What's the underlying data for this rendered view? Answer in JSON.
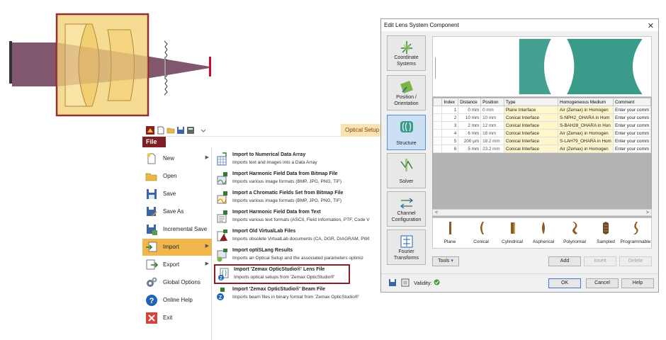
{
  "ribbon": {
    "context_tab": "Optical Setup",
    "file_tab": "File"
  },
  "file_menu": {
    "items": [
      {
        "label": "New",
        "icon": "new-document-icon",
        "has_arrow": true
      },
      {
        "label": "Open",
        "icon": "folder-open-icon",
        "has_arrow": false
      },
      {
        "label": "Save",
        "icon": "floppy-save-icon",
        "has_arrow": false
      },
      {
        "label": "Save As",
        "icon": "save-as-icon",
        "has_arrow": false
      },
      {
        "label": "Incremental Save",
        "icon": "incremental-save-icon",
        "has_arrow": false
      },
      {
        "label": "Import",
        "icon": "import-icon",
        "has_arrow": true,
        "active": true
      },
      {
        "label": "Export",
        "icon": "export-icon",
        "has_arrow": true
      },
      {
        "label": "Global Options",
        "icon": "gears-icon",
        "has_arrow": false
      },
      {
        "label": "Online Help",
        "icon": "help-icon",
        "has_arrow": false
      },
      {
        "label": "Exit",
        "icon": "exit-icon",
        "has_arrow": false
      }
    ]
  },
  "import_menu": {
    "items": [
      {
        "title": "Import to Numerical Data Array",
        "desc": "Imports text and images into a Data Array"
      },
      {
        "title": "Import Harmonic Field Data from Bitmap File",
        "desc": "Imports various image formats (BMP, JPG, PNG, TIF)"
      },
      {
        "title": "Import a Chromatic Fields Set from Bitmap File",
        "desc": "Imports various image formats (BMP, JPG, PNG, TIF)"
      },
      {
        "title": "Import Harmonic Field Data from Text",
        "desc": "Imports various text formats (ASCII, Field Information, PTF, Code V"
      },
      {
        "title": "Import Old VirtualLab Files",
        "desc": "Imports obsolete VirtualLab documents (CA, DGR, DIAGRAM, PWI"
      },
      {
        "title": "Import optiSLang Results",
        "desc": "Imports an Optical Setup and the associated parameters optimiz"
      },
      {
        "title": "Import 'Zemax OpticStudio®' Lens File",
        "desc": "Imports optical setups from 'Zemax OpticStudio®'",
        "highlighted": true
      },
      {
        "title": "Import 'Zemax OpticStudio®' Beam File",
        "desc": "Imports beam files in binary format from 'Zemax OpticStudio®'"
      }
    ]
  },
  "dialog": {
    "title": "Edit Lens System Component",
    "close_glyph": "✕",
    "side_buttons": [
      {
        "label": "Coordinate Systems",
        "icon": "coordinate-systems-icon"
      },
      {
        "label": "Position / Orientation",
        "icon": "position-orientation-icon"
      },
      {
        "label": "Structure",
        "icon": "structure-icon",
        "active": true
      },
      {
        "label": "Solver",
        "icon": "solver-icon"
      },
      {
        "label": "Channel Configuration",
        "icon": "channel-configuration-icon"
      },
      {
        "label": "Fourier Transforms",
        "icon": "fourier-transforms-icon"
      }
    ],
    "table": {
      "columns": [
        "Index",
        "Distance",
        "Position",
        "Type",
        "Homogeneous Medium",
        "Comment"
      ],
      "rows": [
        {
          "index": "1",
          "distance": "0 mm",
          "position": "0 mm",
          "type": "Plane Interface",
          "medium": "Air (Zemax) in Homogen",
          "comment": "Enter your comm"
        },
        {
          "index": "2",
          "distance": "10 mm",
          "position": "10 mm",
          "type": "Conical Interface",
          "medium": "S-NPH2_OHARA in Hom",
          "comment": "Enter your comm"
        },
        {
          "index": "3",
          "distance": "2 mm",
          "position": "12 mm",
          "type": "Conical Interface",
          "medium": "S-BAH28_OHARA in Hon",
          "comment": "Enter your comm"
        },
        {
          "index": "4",
          "distance": "6 mm",
          "position": "18 mm",
          "type": "Conical Interface",
          "medium": "Air (Zemax) in Homogen",
          "comment": "Enter your comm"
        },
        {
          "index": "5",
          "distance": "200 µm",
          "position": "18.2 mm",
          "type": "Conical Interface",
          "medium": "S-LAH79_OHARA in Hom",
          "comment": "Enter your comm"
        },
        {
          "index": "6",
          "distance": "5 mm",
          "position": "23.2 mm",
          "type": "Conical Interface",
          "medium": "Air (Zemax) in Homogen",
          "comment": "Enter your comm"
        }
      ]
    },
    "scroll_left": "<",
    "scroll_right": ">",
    "palette": [
      {
        "label": "Plane",
        "icon": "plane-surface-icon"
      },
      {
        "label": "Conical",
        "icon": "conical-surface-icon"
      },
      {
        "label": "Cylindrical",
        "icon": "cylindrical-surface-icon"
      },
      {
        "label": "Aspherical",
        "icon": "aspherical-surface-icon"
      },
      {
        "label": "Polynomial",
        "icon": "polynomial-surface-icon"
      },
      {
        "label": "Sampled",
        "icon": "sampled-surface-icon"
      },
      {
        "label": "Programmable",
        "icon": "programmable-surface-icon"
      }
    ],
    "tools_label": "Tools",
    "add_label": "Add",
    "insert_label": "Insert",
    "delete_label": "Delete",
    "validity_label": "Validity:",
    "ok_label": "OK",
    "cancel_label": "Cancel",
    "help_label": "Help"
  },
  "colors": {
    "lens_box_fill": "#f6d98a",
    "lens_box_border": "#8b1e24",
    "beam": "#6b3a55",
    "detector": "#c8102e",
    "lens_teal": "#3a9b8a",
    "menu_active": "#f2b74c",
    "file_tab": "#7d1f25"
  }
}
